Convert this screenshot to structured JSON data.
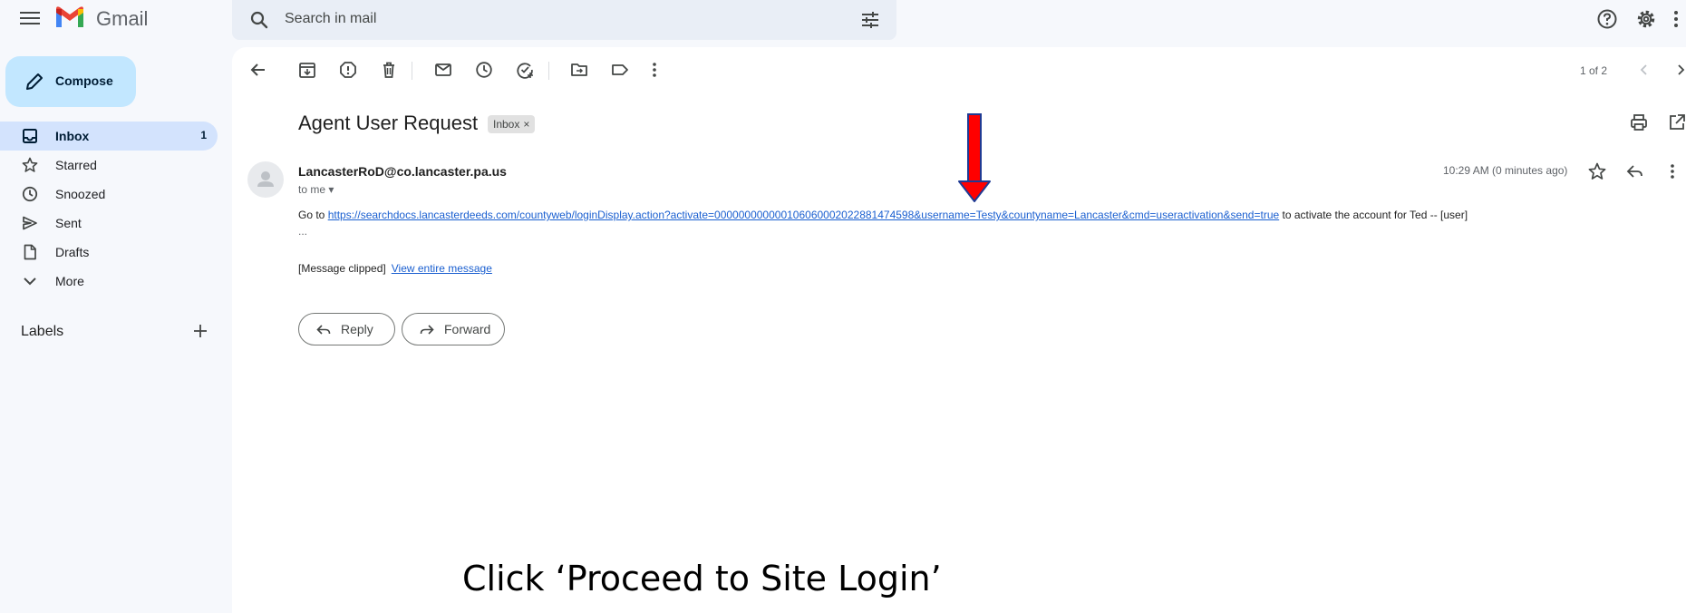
{
  "app": {
    "name": "Gmail",
    "brand_colors": {
      "red": "#ea4335",
      "blue": "#4285f4",
      "green": "#34a853",
      "yellow": "#fbbc04"
    }
  },
  "search": {
    "placeholder": "Search in mail",
    "value": "",
    "icon": "search-icon",
    "filter_icon": "tune-icon"
  },
  "topbar_icons": [
    "help-icon",
    "settings-icon",
    "more-vert-icon"
  ],
  "sidebar": {
    "compose_label": "Compose",
    "items": [
      {
        "label": "Inbox",
        "icon": "inbox-icon",
        "count": "1",
        "active": true
      },
      {
        "label": "Starred",
        "icon": "star-icon",
        "count": ""
      },
      {
        "label": "Snoozed",
        "icon": "clock-icon",
        "count": ""
      },
      {
        "label": "Sent",
        "icon": "send-icon",
        "count": ""
      },
      {
        "label": "Drafts",
        "icon": "draft-icon",
        "count": ""
      },
      {
        "label": "More",
        "icon": "chevron-down-icon",
        "count": ""
      }
    ],
    "labels_header": "Labels"
  },
  "toolbar": {
    "icons": [
      "back-arrow-icon",
      "archive-icon",
      "report-spam-icon",
      "delete-icon",
      "mark-unread-icon",
      "snooze-icon",
      "add-task-icon",
      "move-to-icon",
      "label-icon",
      "more-vert-icon"
    ],
    "pager": "1 of 2"
  },
  "email": {
    "subject": "Agent User Request",
    "label_badge": "Inbox",
    "badge_close": "×",
    "sender": "LancasterRoD@co.lancaster.pa.us",
    "to": "to me",
    "timestamp": "10:29 AM (0 minutes ago)",
    "body_prefix": "Go to ",
    "link": "https://searchdocs.lancasterdeeds.com/countyweb/loginDisplay.action?activate=000000000000106060002022881474598&username=Testy&countyname=Lancaster&cmd=useractivation&send=true",
    "body_suffix": " to activate the account for Ted  --  [user]",
    "ellipsis": "...",
    "clipped_text": "[Message clipped]",
    "view_entire": "View entire message",
    "reply_label": "Reply",
    "forward_label": "Forward"
  },
  "annotation": {
    "caption": "Click ‘Proceed to Site Login’",
    "arrow_color": "#ff0000"
  }
}
